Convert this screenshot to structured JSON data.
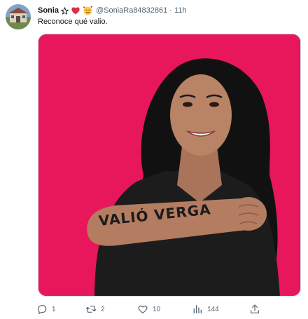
{
  "user": {
    "display_name": "Sonia",
    "name_emojis": [
      "star-emoji",
      "red-heart-emoji",
      "smiling-face-with-hearts-emoji"
    ],
    "handle": "@SoniaRa84832861",
    "separator": "·",
    "time": "11h"
  },
  "tweet": {
    "text": "Reconoce qué valio."
  },
  "media": {
    "background_color": "#e8175b",
    "arm_text": "VALIÓ VERGA"
  },
  "actions": {
    "replies": "1",
    "retweets": "2",
    "likes": "10",
    "views": "144"
  },
  "icons": {
    "reply": "reply-icon",
    "retweet": "retweet-icon",
    "like": "heart-icon",
    "views": "views-chart-icon",
    "share": "share-icon"
  }
}
